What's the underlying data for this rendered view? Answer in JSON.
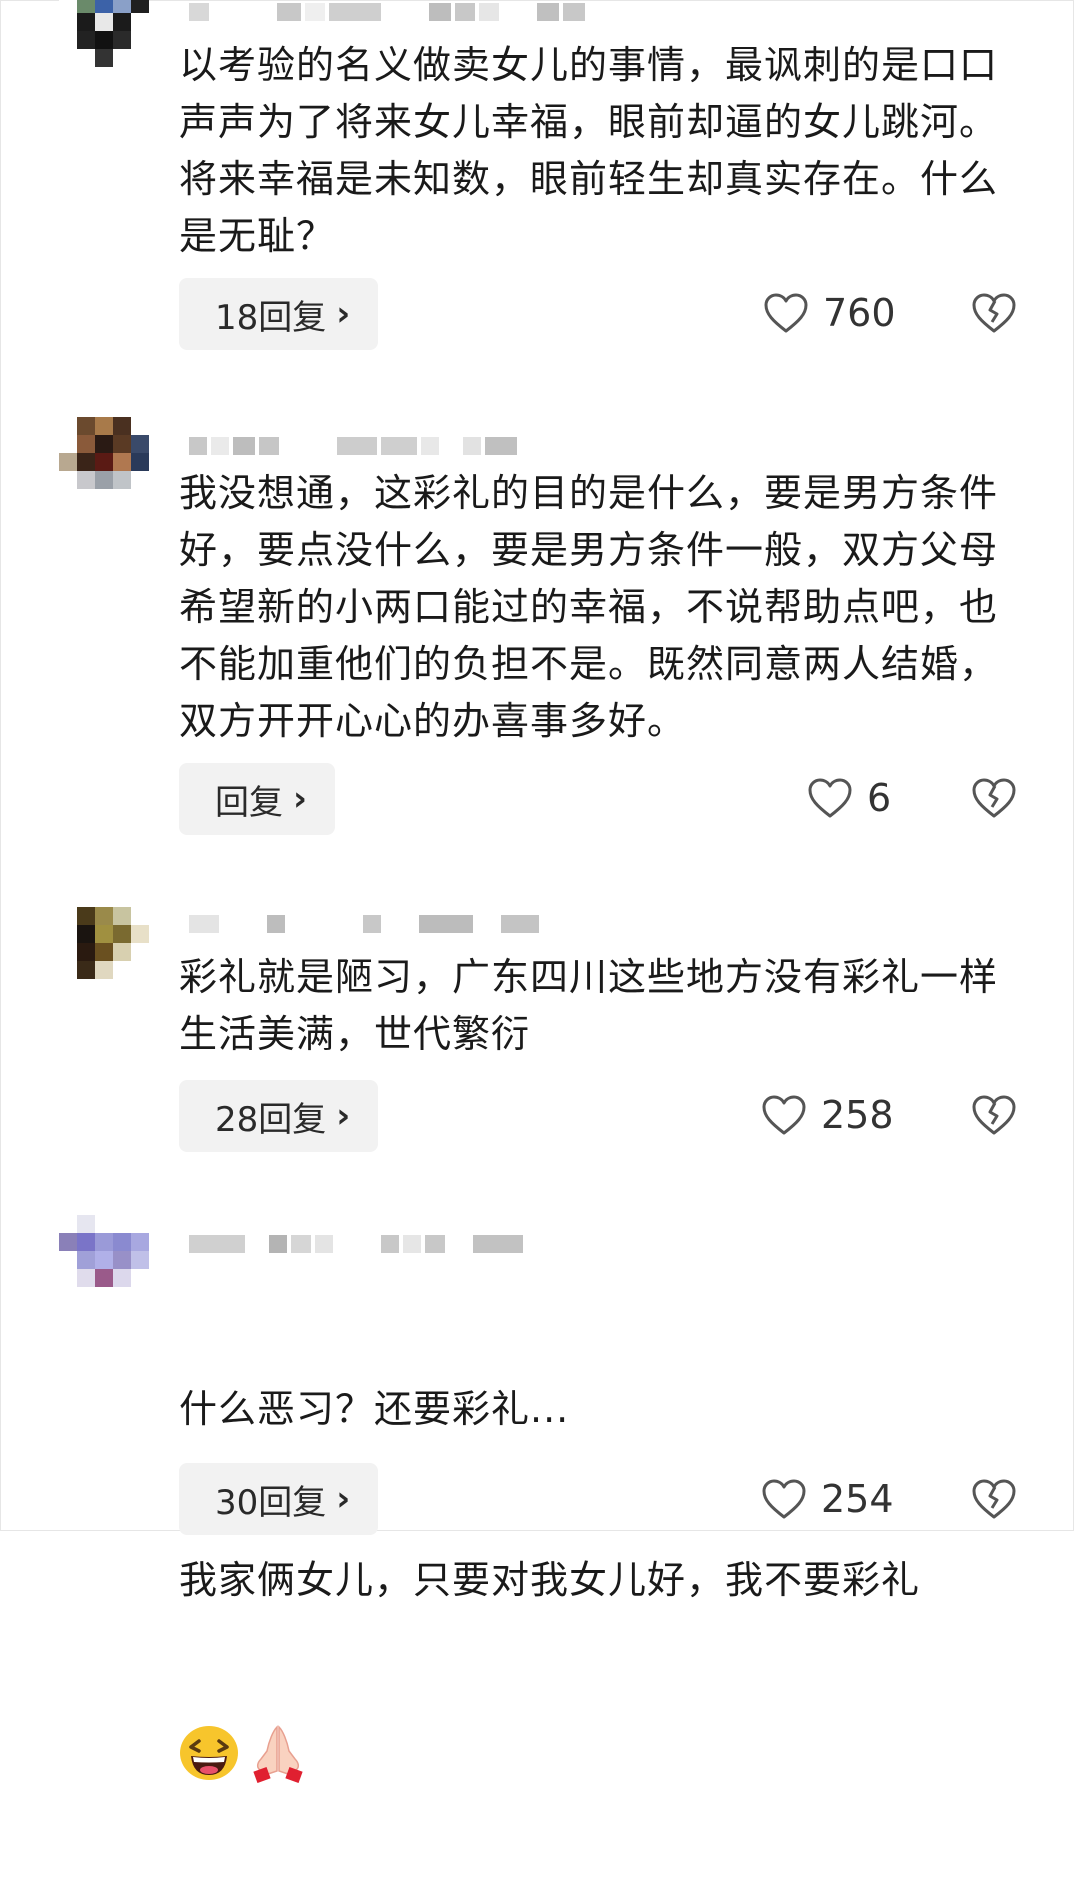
{
  "comments": [
    {
      "text": "以考验的名义做卖女儿的事情，最讽刺的是口口声声为了将来女儿幸福，眼前却逼的女儿跳河。将来幸福是未知数，眼前轻生却真实存在。什么是无耻？",
      "reply_label": "18回复",
      "likes": "760"
    },
    {
      "text": "我没想通，这彩礼的目的是什么，要是男方条件好，要点没什么，要是男方条件一般，双方父母希望新的小两口能过的幸福，不说帮助点吧，也不能加重他们的负担不是。既然同意两人结婚，双方开开心心的办喜事多好。",
      "reply_label": "回复",
      "likes": "6"
    },
    {
      "text": "彩礼就是陋习，广东四川这些地方没有彩礼一样生活美满，世代繁衍",
      "reply_label": "28回复",
      "likes": "258"
    },
    {
      "text_line1": "什么恶习？还要彩礼...",
      "text_line2": "我家俩女儿，只要对我女儿好，我不要彩礼",
      "reply_label": "30回复",
      "likes": "254",
      "emojis": [
        "laughing-face-emoji",
        "praying-hands-emoji"
      ]
    }
  ],
  "icons": {
    "like": "heart-outline-icon",
    "dislike": "broken-heart-icon",
    "chevron": "chevron-right-icon"
  },
  "chevron_glyph": "›",
  "colors": {
    "button_bg": "#f2f2f2",
    "text": "#1a1a1a",
    "icon": "#555555"
  }
}
